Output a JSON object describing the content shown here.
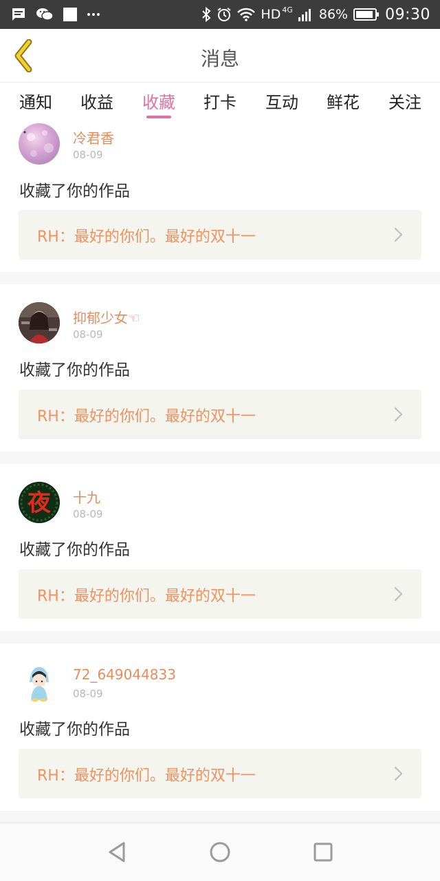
{
  "status_bar": {
    "icons": [
      "message-icon",
      "wechat-icon",
      "square-icon",
      "more-dots-icon"
    ],
    "right_icons": [
      "bluetooth-icon",
      "alarm-icon",
      "wifi-icon"
    ],
    "hd": "HD",
    "network": "4G",
    "battery": "86%",
    "time": "09:30"
  },
  "header": {
    "back_icon": "chevron-left-icon",
    "title": "消息"
  },
  "tabs": [
    {
      "label": "通知",
      "active": false
    },
    {
      "label": "收益",
      "active": false
    },
    {
      "label": "收藏",
      "active": true
    },
    {
      "label": "打卡",
      "active": false
    },
    {
      "label": "互动",
      "active": false
    },
    {
      "label": "鲜花",
      "active": false
    },
    {
      "label": "关注",
      "active": false
    }
  ],
  "accent_color": "#e46fa0",
  "notifications": [
    {
      "username": "冷君香",
      "date": "08-09",
      "action": "收藏了你的作品",
      "work": "RH：最好的你们。最好的双十一"
    },
    {
      "username": "抑郁少女☜",
      "date": "08-09",
      "action": "收藏了你的作品",
      "work": "RH：最好的你们。最好的双十一"
    },
    {
      "username": "十九",
      "date": "08-09",
      "action": "收藏了你的作品",
      "work": "RH：最好的你们。最好的双十一"
    },
    {
      "username": "72_649044833",
      "date": "08-09",
      "action": "收藏了你的作品",
      "work": "RH：最好的你们。最好的双十一"
    }
  ],
  "avatar4_glyph": "夜",
  "nav": {
    "back": "triangle-back-icon",
    "home": "circle-home-icon",
    "recents": "square-recents-icon"
  }
}
